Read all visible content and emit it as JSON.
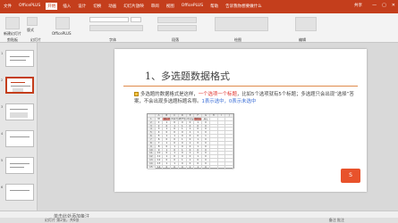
{
  "titlebar": {
    "tabs": [
      "文件",
      "OfficePLUS",
      "开始",
      "插入",
      "设计",
      "切换",
      "动画",
      "幻灯片放映",
      "审阅",
      "视图",
      "OfficePLUS",
      "帮助",
      "告诉我你想要做什么"
    ],
    "active_tab": 2,
    "right_label": "共享"
  },
  "ribbon": {
    "labels": [
      "新建幻灯片",
      "版式",
      "OfficePLUS",
      "剪贴板",
      "幻灯片",
      "字体",
      "段落",
      "绘图",
      "编辑"
    ]
  },
  "thumbnails": {
    "numbers": [
      "1",
      "2",
      "3",
      "4",
      "5",
      "6"
    ]
  },
  "slide": {
    "title": "1、多选题数据格式",
    "para_prefix": "多选题的数据格式是这样，",
    "para_red": "一个选项一个标题",
    "para_mid": "，比如5个选项就有5个标题；多选题只会出现“选择”答案，不会出现多选题标题名称。",
    "para_blue": "1表示选中，0表示未选中",
    "sheet": {
      "headers": [
        "",
        "A",
        "B",
        "C",
        "D",
        "E",
        "F",
        "G",
        "H",
        "I",
        "J"
      ],
      "rows": [
        [
          "1",
          "ID",
          "课程内容",
          "师资力量",
          "教学质量",
          "环境设施",
          "收费标准",
          "其它",
          "",
          "",
          ""
        ],
        [
          "2",
          "1",
          "1",
          "0",
          "0",
          "0",
          "1",
          "0",
          "",
          "",
          ""
        ],
        [
          "3",
          "2",
          "0",
          "1",
          "1",
          "0",
          "0",
          "0",
          "",
          "",
          ""
        ],
        [
          "4",
          "3",
          "1",
          "0",
          "1",
          "1",
          "0",
          "0",
          "",
          "",
          ""
        ],
        [
          "5",
          "4",
          "0",
          "0",
          "0",
          "1",
          "1",
          "0",
          "",
          "",
          ""
        ],
        [
          "6",
          "5",
          "1",
          "1",
          "0",
          "0",
          "0",
          "1",
          "",
          "",
          ""
        ],
        [
          "7",
          "6",
          "0",
          "0",
          "1",
          "0",
          "1",
          "0",
          "",
          "",
          ""
        ],
        [
          "8",
          "7",
          "1",
          "0",
          "0",
          "1",
          "0",
          "0",
          "",
          "",
          ""
        ],
        [
          "9",
          "8",
          "0",
          "1",
          "0",
          "0",
          "1",
          "0",
          "",
          "",
          ""
        ],
        [
          "10",
          "9",
          "1",
          "0",
          "1",
          "0",
          "0",
          "0",
          "",
          "",
          ""
        ],
        [
          "11",
          "10",
          "0",
          "1",
          "0",
          "1",
          "0",
          "0",
          "",
          "",
          ""
        ],
        [
          "12",
          "11",
          "1",
          "0",
          "0",
          "0",
          "1",
          "0",
          "",
          "",
          ""
        ],
        [
          "13",
          "12",
          "0",
          "0",
          "1",
          "1",
          "0",
          "0",
          "",
          "",
          ""
        ],
        [
          "14",
          "13",
          "1",
          "1",
          "0",
          "0",
          "0",
          "0",
          "",
          "",
          ""
        ],
        [
          "15",
          "14",
          "0",
          "0",
          "0",
          "1",
          "1",
          "0",
          "",
          "",
          ""
        ]
      ]
    },
    "logo_text": "S"
  },
  "bottom": {
    "notes_placeholder": "单击此处添加备注",
    "status_left": "幻灯片 第2张，共6张",
    "status_right": "备注 批注"
  },
  "colors": {
    "accent": "#c43e1c",
    "rule": "#e08a4a",
    "highlight": "#f28b82"
  }
}
